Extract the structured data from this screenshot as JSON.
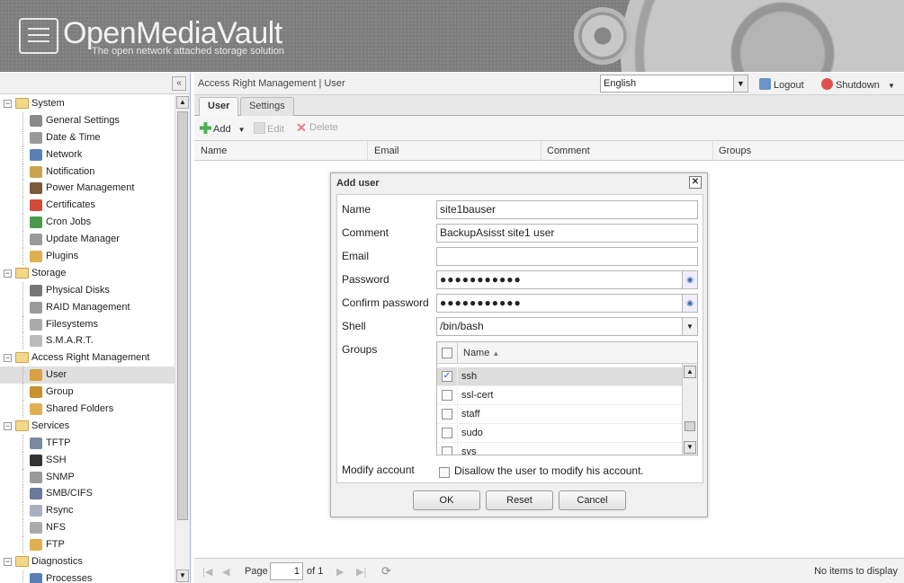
{
  "header": {
    "logo_text": "OpenMediaVault",
    "logo_subtitle": "The open network attached storage solution"
  },
  "nav": {
    "items": [
      {
        "label": "System",
        "level": 0,
        "icon": "folder-icon",
        "expanded": true
      },
      {
        "label": "General Settings",
        "level": 1,
        "icon": "tools-icon",
        "color": "#8a8a8a"
      },
      {
        "label": "Date & Time",
        "level": 1,
        "icon": "clock-icon",
        "color": "#9a9a9a"
      },
      {
        "label": "Network",
        "level": 1,
        "icon": "network-icon",
        "color": "#5a7fb5"
      },
      {
        "label": "Notification",
        "level": 1,
        "icon": "notification-icon",
        "color": "#c9a54d"
      },
      {
        "label": "Power Management",
        "level": 1,
        "icon": "power-icon",
        "color": "#7a5a3a"
      },
      {
        "label": "Certificates",
        "level": 1,
        "icon": "certificate-icon",
        "color": "#d04a3a"
      },
      {
        "label": "Cron Jobs",
        "level": 1,
        "icon": "cron-icon",
        "color": "#4a9a4a"
      },
      {
        "label": "Update Manager",
        "level": 1,
        "icon": "update-icon",
        "color": "#9a9a9a"
      },
      {
        "label": "Plugins",
        "level": 1,
        "icon": "plugin-icon",
        "color": "#e0b050"
      },
      {
        "label": "Storage",
        "level": 0,
        "icon": "folder-icon",
        "expanded": true
      },
      {
        "label": "Physical Disks",
        "level": 1,
        "icon": "disk-icon",
        "color": "#777777"
      },
      {
        "label": "RAID Management",
        "level": 1,
        "icon": "raid-icon",
        "color": "#999999"
      },
      {
        "label": "Filesystems",
        "level": 1,
        "icon": "filesystem-icon",
        "color": "#aaaaaa"
      },
      {
        "label": "S.M.A.R.T.",
        "level": 1,
        "icon": "smart-icon",
        "color": "#bbbbbb"
      },
      {
        "label": "Access Right Management",
        "level": 0,
        "icon": "folder-icon",
        "expanded": true
      },
      {
        "label": "User",
        "level": 1,
        "icon": "user-icon",
        "color": "#d8a040",
        "selected": true
      },
      {
        "label": "Group",
        "level": 1,
        "icon": "group-icon",
        "color": "#c89030"
      },
      {
        "label": "Shared Folders",
        "level": 1,
        "icon": "shared-folder-icon",
        "color": "#e0b050"
      },
      {
        "label": "Services",
        "level": 0,
        "icon": "folder-icon",
        "expanded": true
      },
      {
        "label": "TFTP",
        "level": 1,
        "icon": "tftp-icon",
        "color": "#7a8aa0"
      },
      {
        "label": "SSH",
        "level": 1,
        "icon": "ssh-icon",
        "color": "#333333"
      },
      {
        "label": "SNMP",
        "level": 1,
        "icon": "snmp-icon",
        "color": "#999999"
      },
      {
        "label": "SMB/CIFS",
        "level": 1,
        "icon": "smb-icon",
        "color": "#6a7a9a"
      },
      {
        "label": "Rsync",
        "level": 1,
        "icon": "rsync-icon",
        "color": "#aab0c0"
      },
      {
        "label": "NFS",
        "level": 1,
        "icon": "nfs-icon",
        "color": "#aaaaaa"
      },
      {
        "label": "FTP",
        "level": 1,
        "icon": "ftp-icon",
        "color": "#e0b050"
      },
      {
        "label": "Diagnostics",
        "level": 0,
        "icon": "folder-icon",
        "expanded": true
      },
      {
        "label": "Processes",
        "level": 1,
        "icon": "processes-icon",
        "color": "#5a7fb5"
      }
    ]
  },
  "topbar": {
    "breadcrumb": "Access Right Management | User",
    "language": "English",
    "logout": "Logout",
    "shutdown": "Shutdown"
  },
  "tabs": [
    "User",
    "Settings"
  ],
  "toolbar": {
    "add": "Add",
    "edit": "Edit",
    "delete": "Delete"
  },
  "grid": {
    "columns": [
      "Name",
      "Email",
      "Comment",
      "Groups"
    ]
  },
  "pager": {
    "page_label": "Page",
    "page_value": "1",
    "of_label": "of 1",
    "status": "No items to display"
  },
  "dialog": {
    "title": "Add user",
    "fields": {
      "name_label": "Name",
      "name_value": "site1bauser",
      "comment_label": "Comment",
      "comment_value": "BackupAsisst site1 user",
      "email_label": "Email",
      "email_value": "",
      "password_label": "Password",
      "password_value": "●●●●●●●●●●●",
      "confirm_label": "Confirm password",
      "confirm_value": "●●●●●●●●●●●",
      "shell_label": "Shell",
      "shell_value": "/bin/bash",
      "groups_label": "Groups",
      "modify_label": "Modify account",
      "modify_text": "Disallow the user to modify his account."
    },
    "groups": {
      "header": "Name",
      "rows": [
        {
          "name": "ssh",
          "checked": true
        },
        {
          "name": "ssl-cert",
          "checked": false
        },
        {
          "name": "staff",
          "checked": false
        },
        {
          "name": "sudo",
          "checked": false
        },
        {
          "name": "sys",
          "checked": false
        }
      ]
    },
    "buttons": {
      "ok": "OK",
      "reset": "Reset",
      "cancel": "Cancel"
    }
  },
  "colors": {
    "accent": "#99bbe8",
    "selection": "#dcdcdc",
    "header_gray": "#7d7d7d"
  }
}
